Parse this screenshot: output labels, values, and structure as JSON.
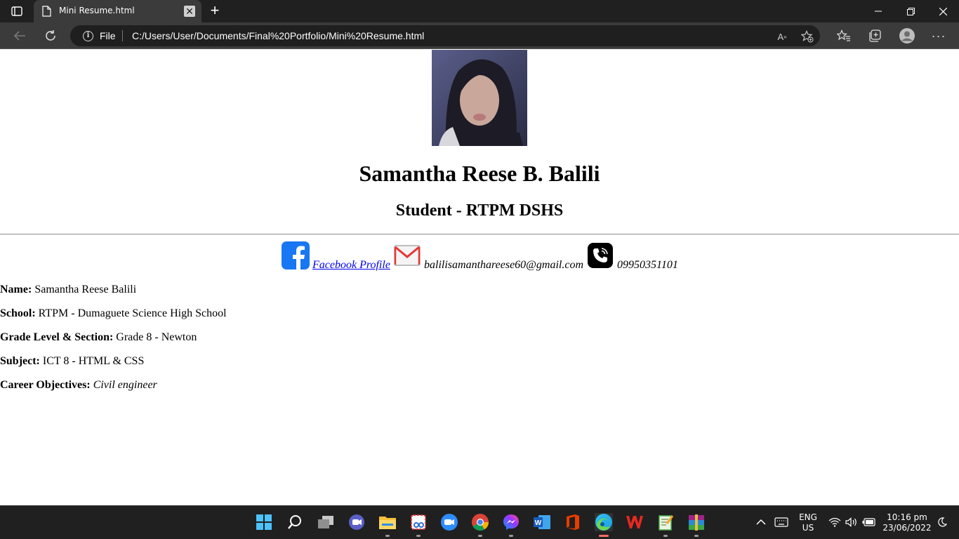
{
  "browser": {
    "tab_title": "Mini Resume.html",
    "address_prefix": "File",
    "url": "C:/Users/User/Documents/Final%20Portfolio/Mini%20Resume.html"
  },
  "resume": {
    "name": "Samantha Reese B. Balili",
    "subtitle": "Student - RTPM DSHS",
    "contacts": {
      "facebook_label": "Facebook Profile",
      "email": "balilisamanthareese60@gmail.com",
      "phone": "09950351101"
    },
    "fields": [
      {
        "label": "Name:",
        "value": "Samantha Reese Balili"
      },
      {
        "label": "School:",
        "value": "RTPM - Dumaguete Science High School"
      },
      {
        "label": "Grade Level & Section:",
        "value": "Grade 8 - Newton"
      },
      {
        "label": "Subject:",
        "value": "ICT 8 - HTML & CSS"
      },
      {
        "label": "Career Objectives:",
        "value": "Civil engineer"
      }
    ]
  },
  "taskbar": {
    "apps": [
      "start-icon",
      "search-icon",
      "task-view-icon",
      "teams-chat-icon",
      "file-explorer-icon",
      "snipping-tool-icon",
      "zoom-icon",
      "chrome-icon",
      "messenger-icon",
      "word-icon",
      "office-icon",
      "edge-icon",
      "wps-icon",
      "notepad-icon",
      "winrar-icon"
    ],
    "language_line1": "ENG",
    "language_line2": "US",
    "time": "10:16 pm",
    "date": "23/06/2022"
  },
  "colors": {
    "chrome_dark": "#202020",
    "chrome_toolbar": "#3b3b3b",
    "link": "#0000ee",
    "facebook": "#1877f2"
  }
}
